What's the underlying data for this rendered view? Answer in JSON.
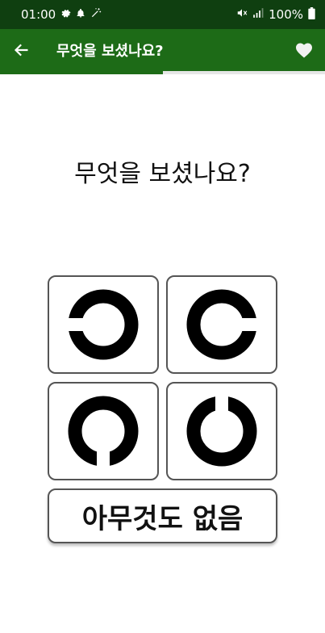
{
  "status_bar": {
    "time": "01:00",
    "battery": "100%"
  },
  "app_bar": {
    "title": "무엇을 보셨나요?"
  },
  "progress": {
    "fraction": 0.5
  },
  "question": {
    "text": "무엇을 보셨나요?"
  },
  "options": [
    {
      "gap_direction": "left"
    },
    {
      "gap_direction": "right"
    },
    {
      "gap_direction": "down"
    },
    {
      "gap_direction": "up"
    }
  ],
  "none_option": {
    "label": "아무것도 없음"
  },
  "colors": {
    "status_bar": "#0f3f10",
    "app_bar": "#1d6b17",
    "ring": "#000000"
  }
}
